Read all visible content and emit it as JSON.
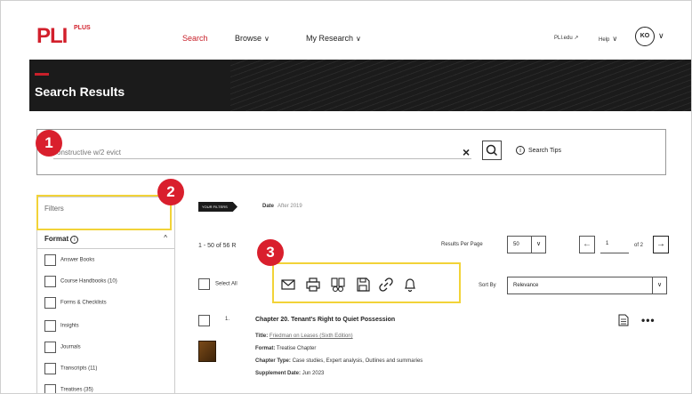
{
  "nav": {
    "logo": "PLI",
    "logo_plus": "PLUS",
    "search": "Search",
    "browse": "Browse",
    "research": "My Research",
    "pli_link": "PLI.edu",
    "help": "Help",
    "avatar_initials": "KO",
    "chevron": "∨",
    "external_arrow": "↗"
  },
  "hero": {
    "title": "Search Results"
  },
  "search": {
    "query": "constructive w/2 evict",
    "clear": "×",
    "tips_label": "Search Tips",
    "tips_icon": "i"
  },
  "sidebar": {
    "filters_label": "Filters",
    "format_label": "Format",
    "format_info_icon": "i",
    "format_caret": "^",
    "facets": [
      "Answer Books",
      "Course Handbooks (10)",
      "Forms & Checklists",
      "Insights",
      "Journals",
      "Transcripts (11)",
      "Treatises (35)"
    ]
  },
  "main": {
    "filters_pill": "YOUR FILTERS",
    "date_label": "Date",
    "date_value": "After 2019",
    "results_count": "1 - 50 of 56 R",
    "rpp_label": "Results Per Page",
    "rpp_value": "50",
    "page_value": "1",
    "page_of": "of 2",
    "prev_arrow": "←",
    "next_arrow": "→",
    "dropdown_arrow": "∨",
    "select_all": "Select All",
    "sort_label": "Sort By",
    "sort_value": "Relevance"
  },
  "result": {
    "number": "1.",
    "title": "Chapter 20. Tenant's Right to Quiet Possession",
    "title_label": "Title:",
    "title_value": "Friedman on Leases (Sixth Edition)",
    "format_label": "Format:",
    "format_value": "Treatise Chapter",
    "type_label": "Chapter Type:",
    "type_value": "Case studies, Expert analysis, Outlines and summaries",
    "supp_label": "Supplement Date:",
    "supp_value": "Jun 2023",
    "more": "•••"
  },
  "annotations": {
    "badge_1": "1",
    "badge_2": "2",
    "badge_3": "3",
    "highlight_color": "#f2d338",
    "badge_color": "#d91f2d"
  },
  "colors": {
    "brand": "#d21f2b",
    "hero_bg": "#1b1b1b"
  }
}
